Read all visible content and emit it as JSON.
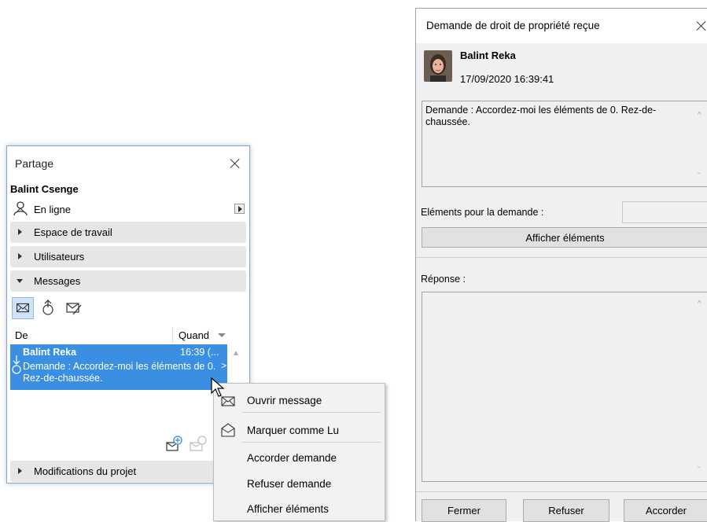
{
  "partage": {
    "title": "Partage",
    "user": "Balint Csenge",
    "status": "En ligne",
    "sections": {
      "workspace": "Espace de travail",
      "users": "Utilisateurs",
      "messages": "Messages",
      "modifications": "Modifications du projet"
    },
    "list": {
      "col_from": "De",
      "col_when": "Quand",
      "selected": {
        "from": "Balint Reka",
        "time": "16:39 (...",
        "body": "Demande : Accordez-moi les éléments de 0. Rez-de-chaussée."
      }
    }
  },
  "context_menu": {
    "items": [
      "Ouvrir message",
      "Marquer comme Lu",
      "Accorder demande",
      "Refuser demande",
      "Afficher éléments"
    ]
  },
  "dialog": {
    "title": "Demande de droit de propriété reçue",
    "sender": "Balint Reka",
    "date": "17/09/2020 16:39:41",
    "request_text": "Demande : Accordez-moi les éléments de 0. Rez-de-chaussée.",
    "elements_label": "Eléments pour la demande :",
    "elements_value": "",
    "show_elements_button": "Afficher éléments",
    "reply_label": "Réponse :",
    "reply_value": "",
    "buttons": {
      "close": "Fermer",
      "refuse": "Refuser",
      "grant": "Accorder"
    }
  },
  "colors": {
    "selection": "#3a8fe3",
    "section_bg": "#e6e6e6",
    "dialog_bg": "#f0f0f0"
  }
}
